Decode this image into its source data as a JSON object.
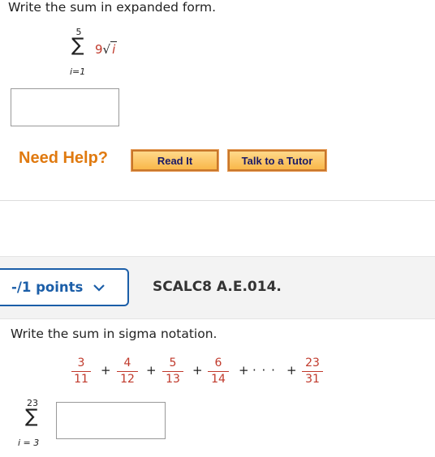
{
  "q1": {
    "instruction": "Write the sum in expanded form.",
    "sigma_upper": "5",
    "sigma_lower": "i=1",
    "coefficient": "9",
    "radicand": "i"
  },
  "help": {
    "need_help": "Need Help?",
    "read_it": "Read It",
    "talk_tutor": "Talk to a Tutor"
  },
  "q2": {
    "points": "-/1 points",
    "question_id": "SCALC8 A.E.014.",
    "instruction": "Write the sum in sigma notation.",
    "fractions": [
      {
        "num": "3",
        "den": "11"
      },
      {
        "num": "4",
        "den": "12"
      },
      {
        "num": "5",
        "den": "13"
      },
      {
        "num": "6",
        "den": "14"
      },
      {
        "num": "23",
        "den": "31"
      }
    ],
    "plus": "+",
    "ellipsis": "· · ·",
    "sigma_upper": "23",
    "sigma_lower": "i = 3"
  },
  "colors": {
    "accent_blue": "#1b5ea8",
    "help_orange": "#e07a10",
    "fraction_red": "#c0392b"
  }
}
